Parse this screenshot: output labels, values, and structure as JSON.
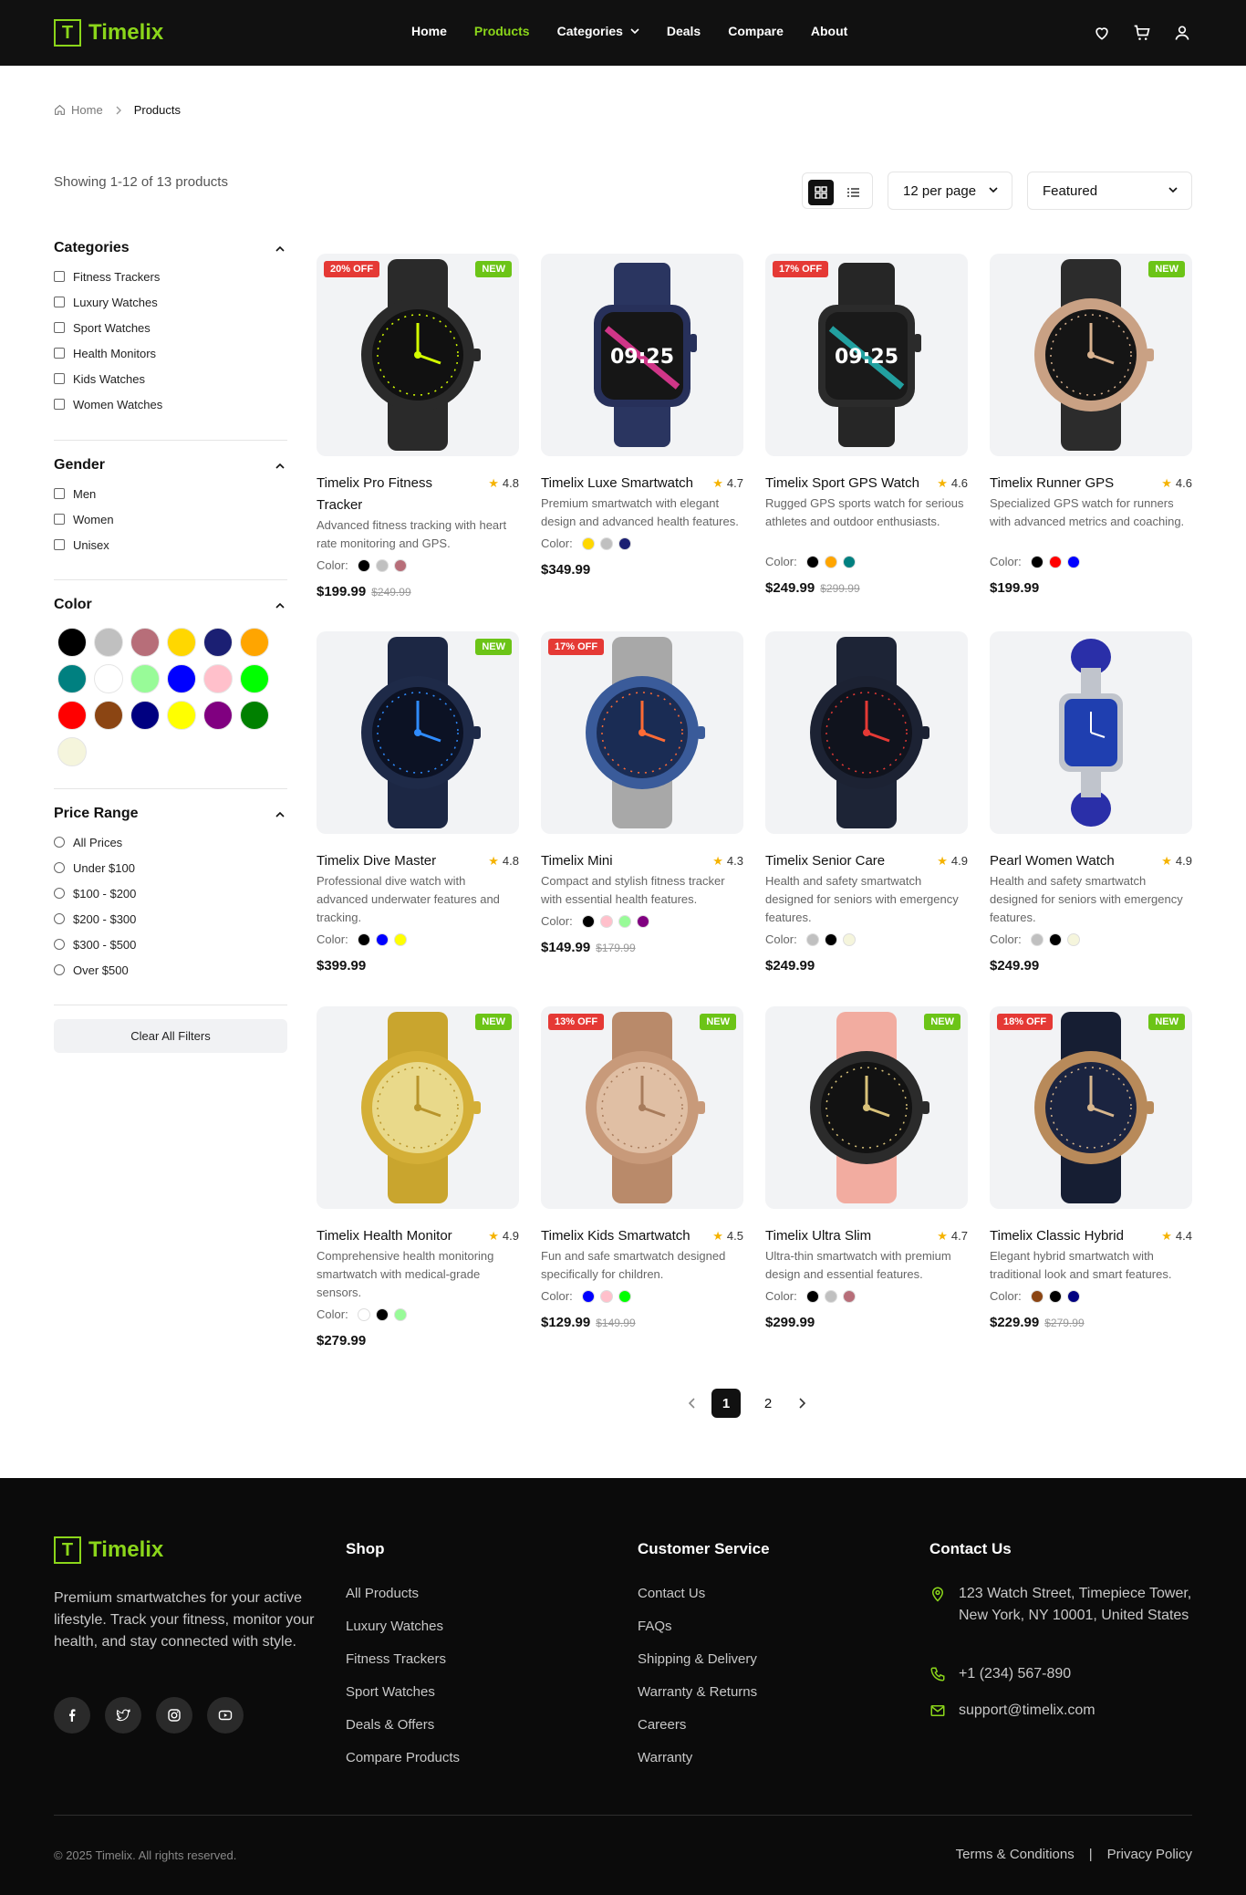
{
  "brand": {
    "letter": "T",
    "name": "Timelix"
  },
  "nav": {
    "items": [
      "Home",
      "Products",
      "Categories",
      "Deals",
      "Compare",
      "About"
    ],
    "active": "Products"
  },
  "breadcrumb": {
    "home": "Home",
    "current": "Products"
  },
  "toolbar": {
    "showing": "Showing 1-12 of 13 products",
    "per_page": "12 per page",
    "sort": "Featured"
  },
  "filters": {
    "categories": {
      "title": "Categories",
      "items": [
        "Fitness Trackers",
        "Luxury Watches",
        "Sport Watches",
        "Health Monitors",
        "Kids Watches",
        "Women Watches"
      ]
    },
    "gender": {
      "title": "Gender",
      "items": [
        "Men",
        "Women",
        "Unisex"
      ]
    },
    "color": {
      "title": "Color",
      "swatches": [
        "#000000",
        "#c0c0c0",
        "#b76e79",
        "#ffd700",
        "#1b1f73",
        "#ffa500",
        "#008080",
        "#ffffff",
        "#98fb98",
        "#0000ff",
        "#ffc0cb",
        "#00ff00",
        "#ff0000",
        "#8b4513",
        "#000080",
        "#ffff00",
        "#800080",
        "#008000",
        "#f5f5dc"
      ]
    },
    "price": {
      "title": "Price Range",
      "items": [
        "All Prices",
        "Under $100",
        "$100 - $200",
        "$200 - $300",
        "$300 - $500",
        "Over $500"
      ]
    },
    "clear_label": "Clear All Filters"
  },
  "products": [
    {
      "name": "Timelix Pro Fitness Tracker",
      "rating": "4.8",
      "desc": "Advanced fitness tracking with heart rate monitoring and GPS.",
      "colors": [
        "#000000",
        "#c0c0c0",
        "#b76e79"
      ],
      "price": "$199.99",
      "old_price": "$249.99",
      "off": "20% OFF",
      "new": "NEW",
      "case": "#2a2a2a",
      "face": "#111",
      "accent": "#d4ff00",
      "strap": "#2a2a2a",
      "shape": "round"
    },
    {
      "name": "Timelix Luxe Smartwatch",
      "rating": "4.7",
      "desc": "Premium smartwatch with elegant design and advanced health features.",
      "colors": [
        "#ffd700",
        "#c0c0c0",
        "#1b1f73"
      ],
      "price": "$349.99",
      "old_price": "",
      "off": "",
      "new": "",
      "case": "#27305a",
      "face": "#161616",
      "accent": "#ff3ea5",
      "strap": "#2a3560",
      "shape": "square"
    },
    {
      "name": "Timelix Sport GPS Watch",
      "rating": "4.6",
      "desc": "Rugged GPS sports watch for serious athletes and outdoor enthusiasts.",
      "colors": [
        "#000000",
        "#ffa500",
        "#008080"
      ],
      "price": "$249.99",
      "old_price": "$299.99",
      "off": "17% OFF",
      "new": "",
      "case": "#2b2b2b",
      "face": "#1a1a1a",
      "accent": "#25c2c2",
      "strap": "#262626",
      "shape": "square"
    },
    {
      "name": "Timelix Runner GPS",
      "rating": "4.6",
      "desc": "Specialized GPS watch for runners with advanced metrics and coaching.",
      "colors": [
        "#000000",
        "#ff0000",
        "#0000ff"
      ],
      "price": "$199.99",
      "old_price": "",
      "off": "",
      "new": "NEW",
      "case": "#c9a184",
      "face": "#151515",
      "accent": "#d9b28f",
      "strap": "#2c2c2c",
      "shape": "round"
    },
    {
      "name": "Timelix Dive Master",
      "rating": "4.8",
      "desc": "Professional dive watch with advanced underwater features and tracking.",
      "colors": [
        "#000000",
        "#0000ff",
        "#ffff00"
      ],
      "price": "$399.99",
      "old_price": "",
      "off": "",
      "new": "NEW",
      "case": "#1e2a48",
      "face": "#0c1224",
      "accent": "#2f8cff",
      "strap": "#1c2744",
      "shape": "round"
    },
    {
      "name": "Timelix Mini",
      "rating": "4.3",
      "desc": "Compact and stylish fitness tracker with essential health features.",
      "colors": [
        "#000000",
        "#ffc0cb",
        "#98fb98",
        "#800080"
      ],
      "price": "$149.99",
      "old_price": "$179.99",
      "off": "17% OFF",
      "new": "",
      "case": "#3a5b9a",
      "face": "#1a2c54",
      "accent": "#ff6b35",
      "strap": "#a8a8a8",
      "shape": "round"
    },
    {
      "name": "Timelix Senior Care",
      "rating": "4.9",
      "desc": "Health and safety smartwatch designed for seniors with emergency features.",
      "colors": [
        "#c0c0c0",
        "#000000",
        "#f5f5dc"
      ],
      "price": "$249.99",
      "old_price": "",
      "off": "",
      "new": "",
      "case": "#1c2233",
      "face": "#10131d",
      "accent": "#e53935",
      "strap": "#1d2436",
      "shape": "round"
    },
    {
      "name": "Pearl Women Watch",
      "rating": "4.9",
      "desc": "Health and safety smartwatch designed for seniors with emergency features.",
      "colors": [
        "#c0c0c0",
        "#000000",
        "#f5f5dc"
      ],
      "price": "$249.99",
      "old_price": "",
      "off": "",
      "new": "",
      "case": "#c0c4cc",
      "face": "#1f3fb0",
      "accent": "#5f78e6",
      "strap": "#2a2fa8",
      "shape": "rect"
    },
    {
      "name": "Timelix Health Monitor",
      "rating": "4.9",
      "desc": "Comprehensive health monitoring smartwatch with medical-grade sensors.",
      "colors": [
        "#ffffff",
        "#000000",
        "#98fb98"
      ],
      "price": "$279.99",
      "old_price": "",
      "off": "",
      "new": "NEW",
      "case": "#d4af37",
      "face": "#e9d98a",
      "accent": "#b8942a",
      "strap": "#c9a52e",
      "shape": "round"
    },
    {
      "name": "Timelix Kids Smartwatch",
      "rating": "4.5",
      "desc": "Fun and safe smartwatch designed specifically for children.",
      "colors": [
        "#0000ff",
        "#ffc0cb",
        "#00ff00"
      ],
      "price": "$129.99",
      "old_price": "$149.99",
      "off": "13% OFF",
      "new": "NEW",
      "case": "#c89a7a",
      "face": "#e0bfa4",
      "accent": "#a77b5b",
      "strap": "#b98a6a",
      "shape": "round"
    },
    {
      "name": "Timelix Ultra Slim",
      "rating": "4.7",
      "desc": "Ultra-thin smartwatch with premium design and essential features.",
      "colors": [
        "#000000",
        "#c0c0c0",
        "#b76e79"
      ],
      "price": "$299.99",
      "old_price": "",
      "off": "",
      "new": "NEW",
      "case": "#2b2b2b",
      "face": "#121212",
      "accent": "#d9c27a",
      "strap": "#f2aca0",
      "shape": "round"
    },
    {
      "name": "Timelix Classic Hybrid",
      "rating": "4.4",
      "desc": "Elegant hybrid smartwatch with traditional look and smart features.",
      "colors": [
        "#8b4513",
        "#000000",
        "#000080"
      ],
      "price": "$229.99",
      "old_price": "$279.99",
      "off": "18% OFF",
      "new": "NEW",
      "case": "#b88a5a",
      "face": "#1b2440",
      "accent": "#d7b68d",
      "strap": "#161e33",
      "shape": "round"
    }
  ],
  "product_labels": {
    "color": "Color:"
  },
  "pagination": {
    "pages": [
      "1",
      "2"
    ],
    "current": "1"
  },
  "footer": {
    "desc": "Premium smartwatches for your active lifestyle. Track your fitness, monitor your health, and stay connected with style.",
    "shop": {
      "title": "Shop",
      "links": [
        "All Products",
        "Luxury Watches",
        "Fitness Trackers",
        "Sport Watches",
        "Deals & Offers",
        "Compare Products"
      ]
    },
    "service": {
      "title": "Customer Service",
      "links": [
        "Contact Us",
        "FAQs",
        "Shipping & Delivery",
        "Warranty & Returns",
        "Careers",
        "Warranty"
      ]
    },
    "contact": {
      "title": "Contact Us",
      "address": "123 Watch Street, Timepiece Tower, New York, NY 10001, United States",
      "phone": "+1 (234) 567-890",
      "email": "support@timelix.com"
    },
    "copyright": "© 2025 Timelix. All rights reserved.",
    "legal": [
      "Terms & Conditions",
      "|",
      "Privacy Policy"
    ]
  }
}
